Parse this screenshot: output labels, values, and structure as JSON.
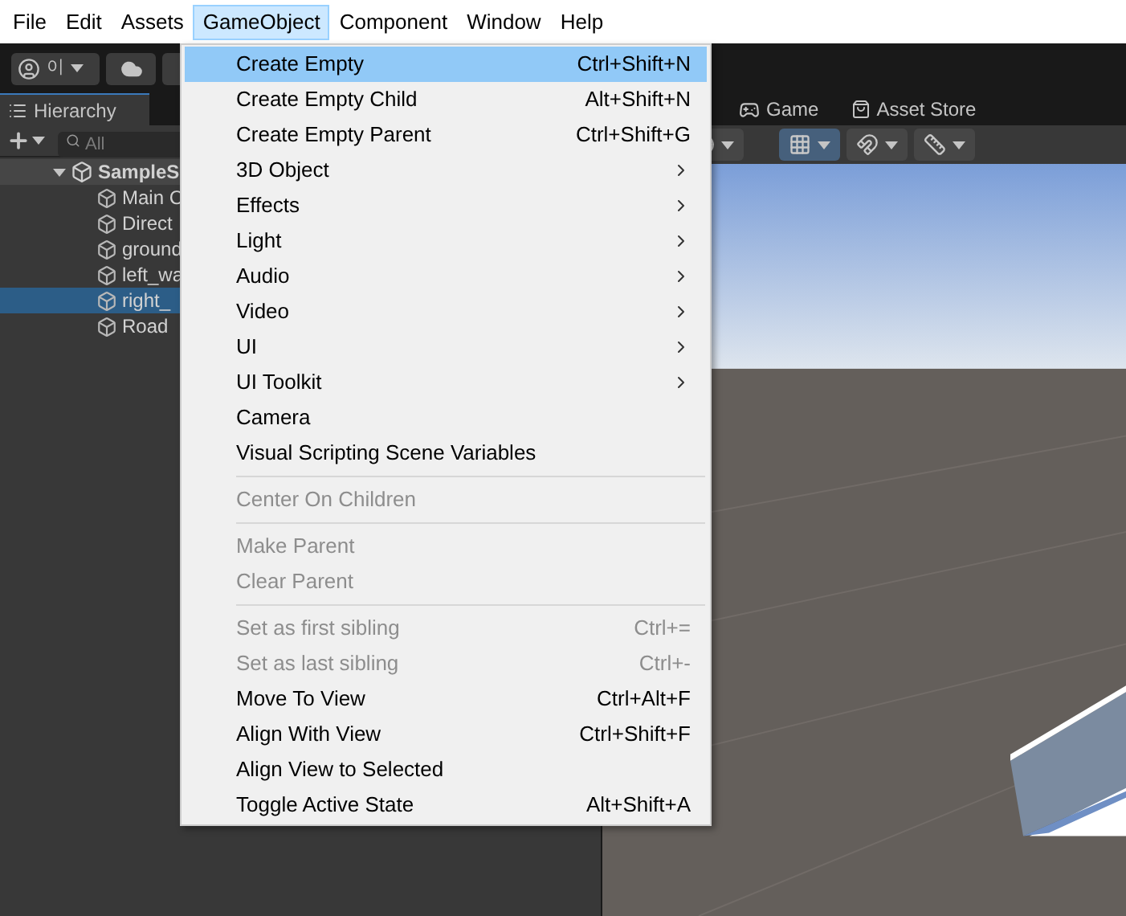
{
  "menubar": [
    {
      "label": "File",
      "selected": false
    },
    {
      "label": "Edit",
      "selected": false
    },
    {
      "label": "Assets",
      "selected": false
    },
    {
      "label": "GameObject",
      "selected": true
    },
    {
      "label": "Component",
      "selected": false
    },
    {
      "label": "Window",
      "selected": false
    },
    {
      "label": "Help",
      "selected": false
    }
  ],
  "toolbar": {
    "account": "이"
  },
  "hierarchy": {
    "tab": "Hierarchy",
    "search": {
      "placeholder": "All"
    },
    "scene": "SampleS",
    "rows": [
      {
        "label": "Main C",
        "selected": false
      },
      {
        "label": "Direct",
        "selected": false
      },
      {
        "label": "ground",
        "selected": false
      },
      {
        "label": "left_wa",
        "selected": false
      },
      {
        "label": "right_",
        "selected": true
      },
      {
        "label": "Road",
        "selected": false
      }
    ]
  },
  "view_tabs": [
    "Game",
    "Asset Store"
  ],
  "scene_toolbar": [
    {
      "kind": "globe",
      "selected": false
    },
    {
      "kind": "grid",
      "selected": true
    },
    {
      "kind": "snap",
      "selected": false
    },
    {
      "kind": "ruler",
      "selected": false
    }
  ],
  "menu": [
    {
      "kind": "item",
      "label": "Create Empty",
      "shortcut": "Ctrl+Shift+N",
      "selected": true,
      "disabled": false
    },
    {
      "kind": "item",
      "label": "Create Empty Child",
      "shortcut": "Alt+Shift+N",
      "selected": false,
      "disabled": false
    },
    {
      "kind": "item",
      "label": "Create Empty Parent",
      "shortcut": "Ctrl+Shift+G",
      "selected": false,
      "disabled": false
    },
    {
      "kind": "submenu",
      "label": "3D Object",
      "selected": false,
      "disabled": false
    },
    {
      "kind": "submenu",
      "label": "Effects",
      "selected": false,
      "disabled": false
    },
    {
      "kind": "submenu",
      "label": "Light",
      "selected": false,
      "disabled": false
    },
    {
      "kind": "submenu",
      "label": "Audio",
      "selected": false,
      "disabled": false
    },
    {
      "kind": "submenu",
      "label": "Video",
      "selected": false,
      "disabled": false
    },
    {
      "kind": "submenu",
      "label": "UI",
      "selected": false,
      "disabled": false
    },
    {
      "kind": "submenu",
      "label": "UI Toolkit",
      "selected": false,
      "disabled": false
    },
    {
      "kind": "item",
      "label": "Camera",
      "selected": false,
      "disabled": false
    },
    {
      "kind": "item",
      "label": "Visual Scripting Scene Variables",
      "selected": false,
      "disabled": false
    },
    {
      "kind": "separator"
    },
    {
      "kind": "item",
      "label": "Center On Children",
      "selected": false,
      "disabled": true
    },
    {
      "kind": "separator"
    },
    {
      "kind": "item",
      "label": "Make Parent",
      "selected": false,
      "disabled": true
    },
    {
      "kind": "item",
      "label": "Clear Parent",
      "selected": false,
      "disabled": true
    },
    {
      "kind": "separator"
    },
    {
      "kind": "item",
      "label": "Set as first sibling",
      "shortcut": "Ctrl+=",
      "selected": false,
      "disabled": true
    },
    {
      "kind": "item",
      "label": "Set as last sibling",
      "shortcut": "Ctrl+-",
      "selected": false,
      "disabled": true
    },
    {
      "kind": "item",
      "label": "Move To View",
      "shortcut": "Ctrl+Alt+F",
      "selected": false,
      "disabled": false
    },
    {
      "kind": "item",
      "label": "Align With View",
      "shortcut": "Ctrl+Shift+F",
      "selected": false,
      "disabled": false
    },
    {
      "kind": "item",
      "label": "Align View to Selected",
      "selected": false,
      "disabled": false
    },
    {
      "kind": "item",
      "label": "Toggle Active State",
      "shortcut": "Alt+Shift+A",
      "selected": false,
      "disabled": false
    }
  ]
}
